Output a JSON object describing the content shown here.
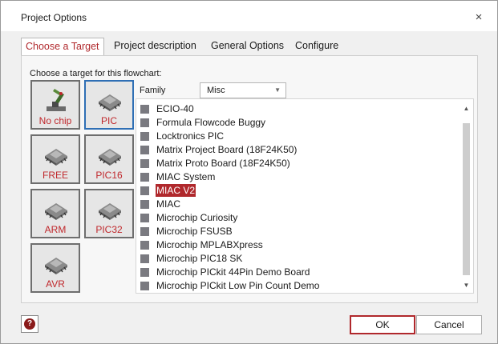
{
  "window": {
    "title": "Project Options",
    "close_icon": "×"
  },
  "tabs": [
    {
      "label": "Choose a Target",
      "active": true
    },
    {
      "label": "Project description",
      "active": false
    },
    {
      "label": "General Options",
      "active": false
    },
    {
      "label": "Configure",
      "active": false
    }
  ],
  "target_panel": {
    "instruction": "Choose a target for this flowchart:",
    "targets": [
      {
        "label": "No chip",
        "icon": "robot-arm-icon",
        "selected": false
      },
      {
        "label": "PIC",
        "icon": "chip-icon",
        "selected": true
      },
      {
        "label": "FREE",
        "icon": "chip-icon",
        "selected": false
      },
      {
        "label": "PIC16",
        "icon": "chip-icon",
        "selected": false
      },
      {
        "label": "ARM",
        "icon": "chip-icon",
        "selected": false
      },
      {
        "label": "PIC32",
        "icon": "chip-icon",
        "selected": false
      },
      {
        "label": "AVR",
        "icon": "chip-icon",
        "selected": false
      }
    ]
  },
  "family": {
    "label": "Family",
    "value": "Misc"
  },
  "device_list": {
    "items": [
      "ECIO-40",
      "Formula Flowcode Buggy",
      "Locktronics PIC",
      "Matrix Project Board (18F24K50)",
      "Matrix Proto Board (18F24K50)",
      "MIAC System",
      "MIAC V2",
      "MIAC",
      "Microchip Curiosity",
      "Microchip FSUSB",
      "Microchip MPLABXpress",
      "Microchip PIC18 SK",
      "Microchip PICkit 44Pin Demo Board",
      "Microchip PICkit Low Pin Count Demo"
    ],
    "selected": "MIAC V2"
  },
  "footer": {
    "help_icon": "?",
    "ok_label": "OK",
    "cancel_label": "Cancel"
  },
  "colors": {
    "accent": "#b0282c",
    "selection_border": "#2f6fb5"
  }
}
